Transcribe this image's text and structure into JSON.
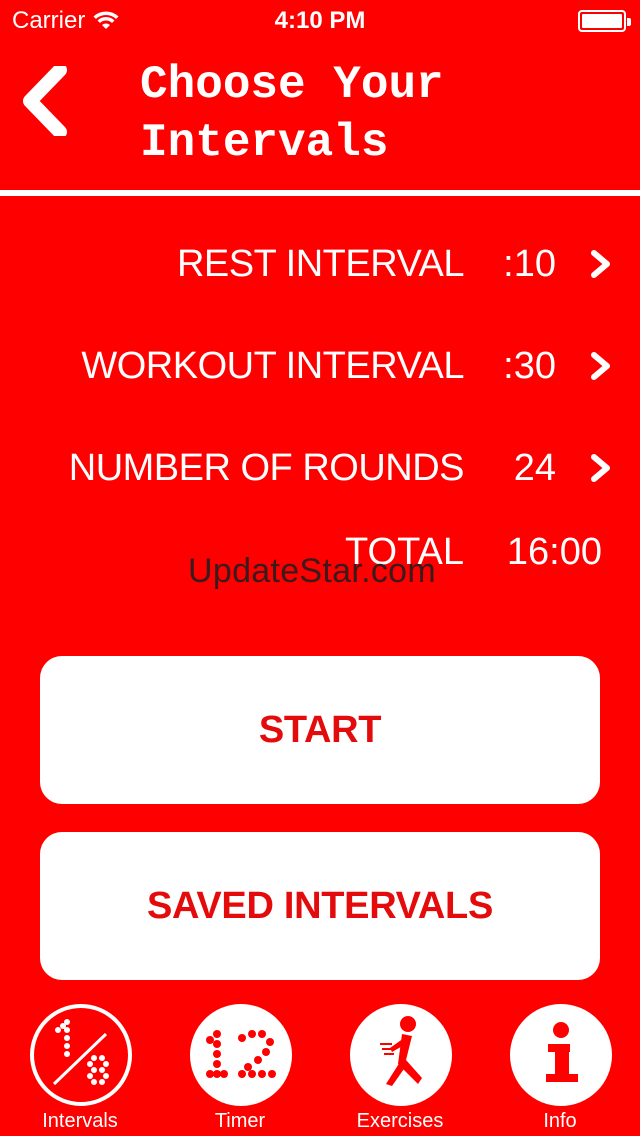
{
  "status_bar": {
    "carrier": "Carrier",
    "time": "4:10 PM",
    "battery_level": 1.0
  },
  "nav": {
    "title_line1": "Choose Your",
    "title_line2": "Intervals",
    "back_icon": "chevron-left-icon"
  },
  "settings": [
    {
      "label": "REST INTERVAL",
      "value": ":10"
    },
    {
      "label": "WORKOUT INTERVAL",
      "value": ":30"
    },
    {
      "label": "NUMBER OF ROUNDS",
      "value": "24"
    }
  ],
  "total": {
    "label": "TOTAL",
    "value": "16:00"
  },
  "watermark": "UpdateStar.com",
  "buttons": {
    "start": "START",
    "saved": "SAVED INTERVALS"
  },
  "tabs": [
    {
      "label": "Intervals",
      "icon": "fraction-icon",
      "selected": true
    },
    {
      "label": "Timer",
      "icon": "dot-matrix-number-icon",
      "selected": false
    },
    {
      "label": "Exercises",
      "icon": "exercise-figure-icon",
      "selected": false
    },
    {
      "label": "Info",
      "icon": "info-icon",
      "selected": false
    }
  ],
  "colors": {
    "background": "#fe0000",
    "button_text": "#e30b0b",
    "foreground": "#ffffff"
  }
}
